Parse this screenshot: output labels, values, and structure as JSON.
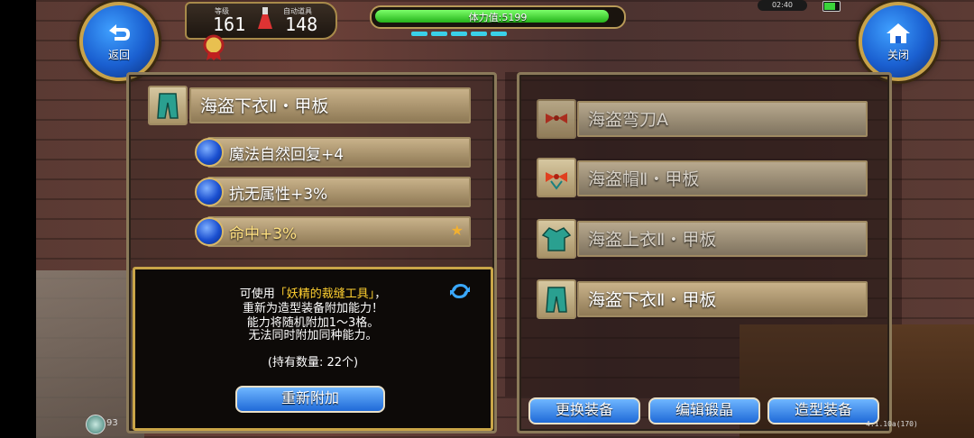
{
  "hud": {
    "back_label": "返回",
    "close_label": "关闭",
    "level_label": "等级",
    "level_value": "161",
    "auto_potion_label": "自动道具",
    "auto_potion_value": "148",
    "hp_text": "体力值:5199",
    "hp_fraction": 0.98,
    "clock": "02:40"
  },
  "left_panel": {
    "item_name": "海盗下衣Ⅱ・甲板",
    "abilities": [
      {
        "label": "魔法自然回复+4"
      },
      {
        "label": "抗无属性+3%"
      },
      {
        "label": "命中+3%",
        "starred": true
      }
    ]
  },
  "info": {
    "line1_prefix": "可使用",
    "line1_highlight": "「妖精的裁缝工具」",
    "line1_suffix": "，",
    "line2": "重新为造型装备附加能力！",
    "line3": "能力将随机附加1～3格。",
    "line4": "无法同时附加同种能力。",
    "count_line": "(持有数量: 22个)",
    "reapply_button": "重新附加"
  },
  "right_panel": {
    "items": [
      {
        "label": "海盗弯刀A",
        "icon": "bow-icon"
      },
      {
        "label": "海盗帽Ⅱ・甲板",
        "icon": "bow-icon"
      },
      {
        "label": "海盗上衣Ⅱ・甲板",
        "icon": "shirt-icon"
      },
      {
        "label": "海盗下衣Ⅱ・甲板",
        "icon": "pants-icon"
      }
    ],
    "buttons": {
      "change": "更换装备",
      "edit": "编辑锻晶",
      "styling": "造型装备"
    }
  },
  "footer": {
    "left_number": "93",
    "version": "4.1.10a(170)"
  },
  "colors": {
    "accent_gold": "#c9a548",
    "button_blue": "#1f6ad8",
    "highlight_yellow": "#ffd030"
  }
}
